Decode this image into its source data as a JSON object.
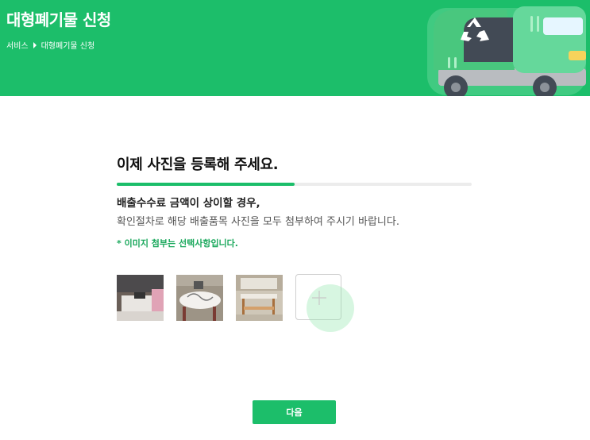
{
  "header": {
    "title": "대형폐기물 신청",
    "breadcrumb": [
      "서비스",
      "대형폐기물 신청"
    ],
    "accent_color": "#1cbe6a"
  },
  "main": {
    "step_title": "이제 사진을 등록해 주세요.",
    "progress_fraction": 0.5,
    "sub_title": "배출수수료 금액이 상이할 경우,",
    "description": "확인절차로 해당 배출품목 사진을 모두 첨부하여 주시기 바랍니다.",
    "note": "* 이미지 첨부는 선택사항입니다.",
    "photos": [
      "desk-photo-1",
      "desk-photo-2",
      "desk-photo-3"
    ],
    "add_photo_icon": "plus-icon"
  },
  "footer": {
    "next_label": "다음"
  }
}
